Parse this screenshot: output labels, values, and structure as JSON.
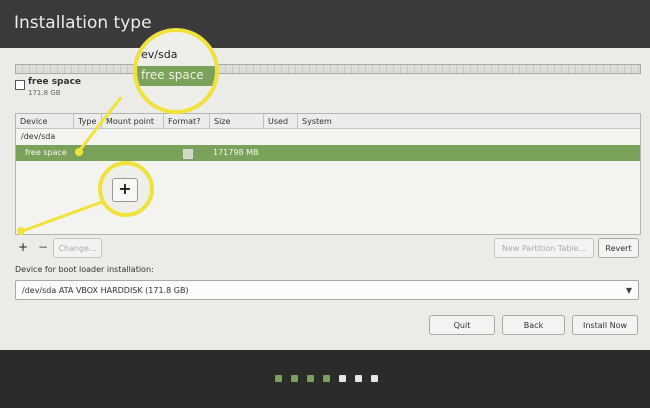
{
  "window": {
    "title": "Installation type"
  },
  "partition_bar": {
    "label": "free space",
    "size": "171.8 GB"
  },
  "table": {
    "headers": [
      "Device",
      "Type",
      "Mount point",
      "Format?",
      "Size",
      "Used",
      "System"
    ],
    "device_row": "/dev/sda",
    "selected_row": {
      "device": "free space",
      "size": "171798 MB"
    }
  },
  "actions": {
    "add": "+",
    "remove": "−",
    "change": "Change...",
    "new_table": "New Partition Table...",
    "revert": "Revert"
  },
  "bootloader": {
    "label": "Device for boot loader installation:",
    "value": "/dev/sda    ATA VBOX HARDDISK (171.8 GB)"
  },
  "buttons": {
    "quit": "Quit",
    "back": "Back",
    "install": "Install Now"
  },
  "zoom_callouts": {
    "top_line1": "ev/sda",
    "top_line2": "free space",
    "plus": "+"
  },
  "progress": {
    "total_steps": 7,
    "completed_steps": 4,
    "active_color": "#7aa25a",
    "inactive_color": "#e6e6e6",
    "highlight_color": "#f1e23b"
  }
}
